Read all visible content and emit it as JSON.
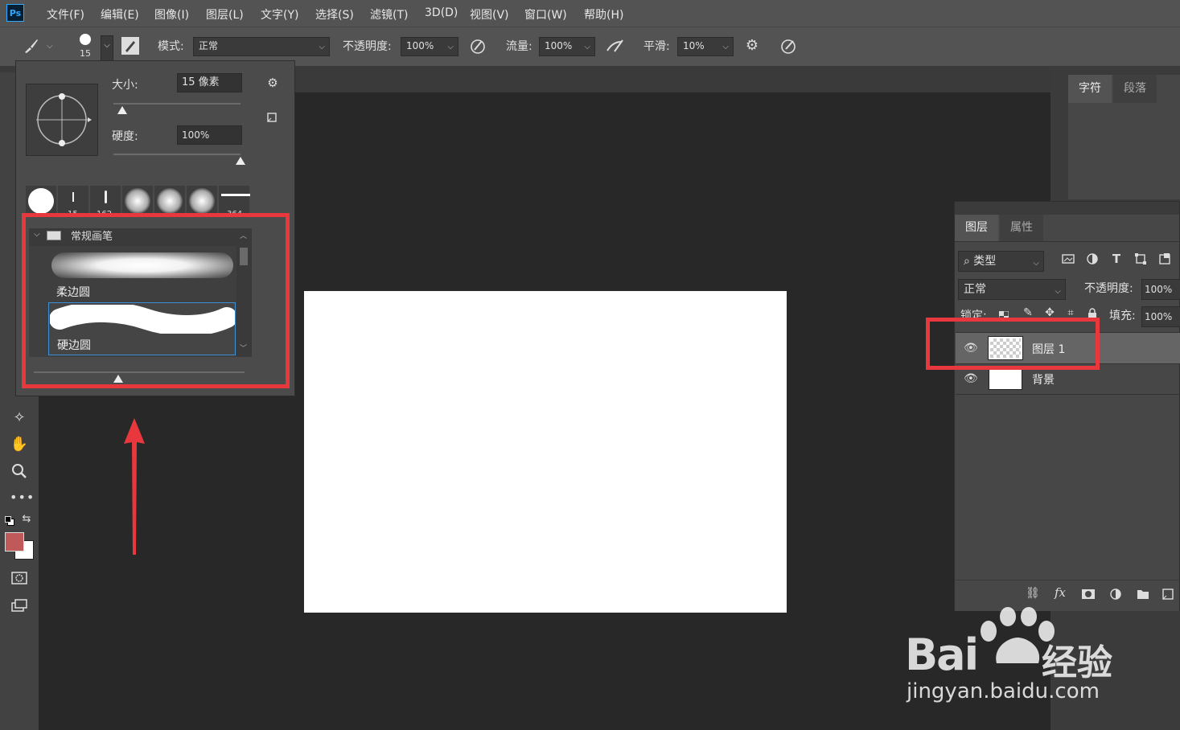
{
  "app": {
    "logo": "Ps"
  },
  "menu": [
    "文件(F)",
    "编辑(E)",
    "图像(I)",
    "图层(L)",
    "文字(Y)",
    "选择(S)",
    "滤镜(T)",
    "3D(D)",
    "视图(V)",
    "窗口(W)",
    "帮助(H)"
  ],
  "options": {
    "brush_size": "15",
    "mode_label": "模式:",
    "mode_value": "正常",
    "opacity_label": "不透明度:",
    "opacity_value": "100%",
    "flow_label": "流量:",
    "flow_value": "100%",
    "smooth_label": "平滑:",
    "smooth_value": "10%"
  },
  "brush_popup": {
    "size_label": "大小:",
    "size_value": "15 像素",
    "hardness_label": "硬度:",
    "hardness_value": "100%",
    "size_slider_fraction": 0.07,
    "hardness_slider_fraction": 1.0,
    "presets": [
      {
        "label": ""
      },
      {
        "label": "15"
      },
      {
        "label": "162"
      },
      {
        "label": ""
      },
      {
        "label": ""
      },
      {
        "label": ""
      },
      {
        "label": "364"
      }
    ],
    "group_name": "常规画笔",
    "brushes": [
      {
        "name": "柔边圆",
        "selected": false
      },
      {
        "name": "硬边圆",
        "selected": true
      }
    ],
    "preview_slider_fraction": 0.4
  },
  "char_panel": {
    "tabs": [
      "字符",
      "段落"
    ]
  },
  "layers_panel": {
    "tabs": [
      "图层",
      "属性"
    ],
    "filter_label": "类型",
    "blend_mode": "正常",
    "opacity_label": "不透明度:",
    "opacity_value": "100%",
    "lock_label": "锁定:",
    "fill_label": "填充:",
    "fill_value": "100%",
    "layers": [
      {
        "name": "图层 1",
        "selected": true,
        "thumb": "transparent"
      },
      {
        "name": "背景",
        "selected": false,
        "thumb": "white"
      }
    ]
  },
  "colors": {
    "foreground": "#c0595a",
    "background": "#ffffff",
    "highlight": "#e8383d",
    "ps_blue": "#31a8ff"
  },
  "watermark": {
    "brand": "Bai",
    "brand_cn": "经验",
    "url": "jingyan.baidu.com"
  }
}
